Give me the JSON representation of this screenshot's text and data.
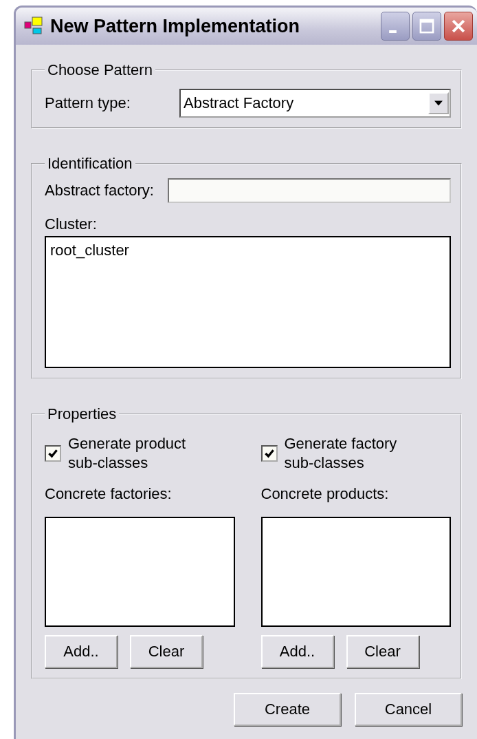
{
  "window": {
    "title": "New Pattern Implementation"
  },
  "choose_pattern": {
    "legend": "Choose Pattern",
    "label": "Pattern type:",
    "value": "Abstract Factory"
  },
  "identification": {
    "legend": "Identification",
    "abstract_factory_label": "Abstract factory:",
    "cluster_label": "Cluster:",
    "cluster_items": [
      "root_cluster"
    ]
  },
  "properties": {
    "legend": "Properties",
    "columns": [
      {
        "checkbox_label": "Generate product sub-classes",
        "checked": true,
        "list_label": "Concrete factories:",
        "buttons": [
          "Add..",
          "Clear"
        ]
      },
      {
        "checkbox_label": "Generate factory sub-classes",
        "checked": true,
        "list_label": "Concrete products:",
        "buttons": [
          "Add..",
          "Clear"
        ]
      }
    ]
  },
  "buttons": [
    "Create",
    "Cancel"
  ]
}
